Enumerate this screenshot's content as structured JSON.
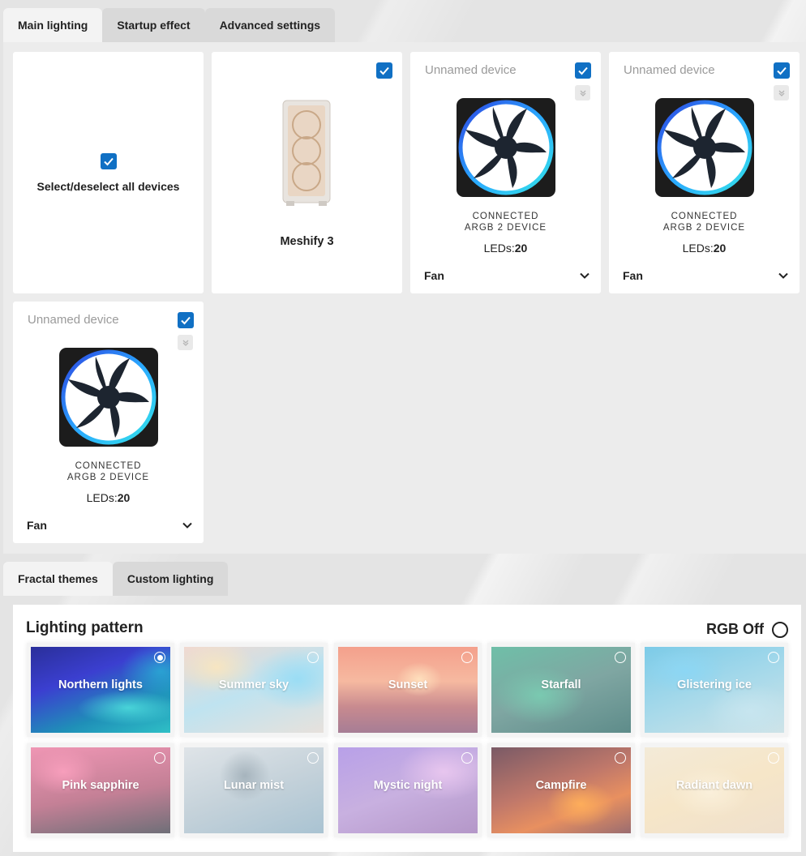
{
  "top_tabs": [
    "Main lighting",
    "Startup effect",
    "Advanced settings"
  ],
  "devices": {
    "select_all_label": "Select/deselect all devices",
    "case_name": "Meshify 3",
    "unnamed_title": "Unnamed device",
    "device_kind_line1": "CONNECTED",
    "device_kind_line2": "ARGB 2 DEVICE",
    "leds_label": "LEDs:",
    "leds_value": "20",
    "fan_type": "Fan"
  },
  "bottom_tabs": [
    "Fractal themes",
    "Custom lighting"
  ],
  "lighting": {
    "title": "Lighting pattern",
    "rgb_off_label": "RGB Off",
    "selected_theme": "Northern lights",
    "themes": [
      "Northern lights",
      "Summer sky",
      "Sunset",
      "Starfall",
      "Glistering ice",
      "Pink sapphire",
      "Lunar mist",
      "Mystic night",
      "Campfire",
      "Radiant dawn"
    ]
  },
  "colors": {
    "accent": "#1070c4",
    "card_bg": "#ffffff",
    "panel_bg": "#ececec"
  }
}
